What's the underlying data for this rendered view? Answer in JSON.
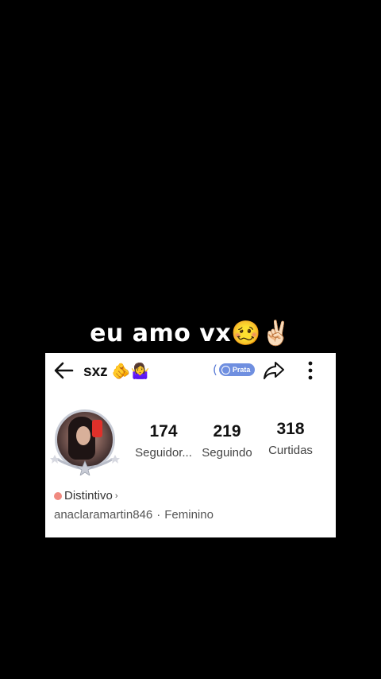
{
  "caption": {
    "text": "eu amo vx🥴✌🏻"
  },
  "profile": {
    "username": "sxz 🫵🤷‍♀️",
    "level_badge": {
      "open_paren": "(",
      "label": "Prata"
    },
    "stats": [
      {
        "value": "174",
        "label": "Seguidor..."
      },
      {
        "value": "219",
        "label": "Seguindo"
      },
      {
        "value": "318",
        "label": "Curtidas"
      }
    ],
    "distintivo_label": "Distintivo",
    "distintivo_chevron": "›",
    "handle": "anaclaramartin846",
    "separator": "·",
    "gender": "Feminino"
  },
  "colors": {
    "badge": "#6f8fe0",
    "distintivo_dot": "#f08a80",
    "background": "#000000",
    "card": "#ffffff"
  },
  "icons": [
    "back-arrow-icon",
    "badge-icon",
    "share-icon",
    "more-vertical-icon"
  ]
}
